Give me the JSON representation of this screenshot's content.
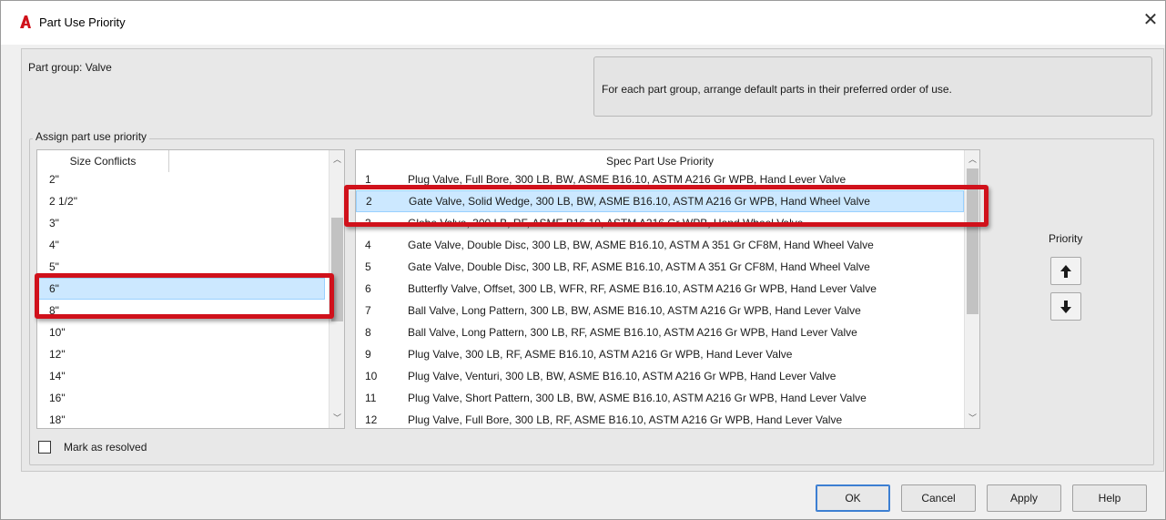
{
  "window": {
    "title": "Part Use Priority",
    "close_glyph": "✕",
    "app_icon": "autocad-icon"
  },
  "part_group_label": "Part group: Valve",
  "info_text": "For each part group, arrange default parts in their preferred order of use.",
  "group_title": "Assign part use priority",
  "size_list": {
    "header": "Size Conflicts",
    "items": [
      "2\"",
      "2 1/2\"",
      "3\"",
      "4\"",
      "5\"",
      "6\"",
      "8\"",
      "10\"",
      "12\"",
      "14\"",
      "16\"",
      "18\""
    ],
    "selected": "6\""
  },
  "spec_list": {
    "header": "Spec Part Use Priority",
    "rows": [
      {
        "num": "1",
        "text": "Plug Valve, Full Bore, 300 LB, BW, ASME B16.10, ASTM A216 Gr WPB, Hand Lever Valve"
      },
      {
        "num": "2",
        "text": "Gate Valve, Solid Wedge, 300 LB, BW, ASME B16.10, ASTM A216 Gr WPB, Hand Wheel Valve"
      },
      {
        "num": "3",
        "text": "Globe Valve, 300 LB, RF, ASME B16.10, ASTM A216 Gr WPB, Hand Wheel Valve"
      },
      {
        "num": "4",
        "text": "Gate Valve, Double Disc, 300 LB, BW, ASME B16.10, ASTM A 351 Gr CF8M, Hand Wheel Valve"
      },
      {
        "num": "5",
        "text": "Gate Valve, Double Disc, 300 LB, RF, ASME B16.10, ASTM A 351 Gr CF8M, Hand Wheel Valve"
      },
      {
        "num": "6",
        "text": "Butterfly Valve, Offset, 300 LB, WFR, RF, ASME B16.10, ASTM A216 Gr WPB, Hand Lever Valve"
      },
      {
        "num": "7",
        "text": "Ball Valve, Long Pattern, 300 LB, BW, ASME B16.10, ASTM A216 Gr WPB, Hand Lever Valve"
      },
      {
        "num": "8",
        "text": "Ball Valve, Long Pattern, 300 LB, RF, ASME B16.10, ASTM A216 Gr WPB, Hand Lever Valve"
      },
      {
        "num": "9",
        "text": "Plug Valve, 300 LB, RF, ASME B16.10, ASTM A216 Gr WPB, Hand Lever Valve"
      },
      {
        "num": "10",
        "text": "Plug Valve, Venturi, 300 LB, BW, ASME B16.10, ASTM A216 Gr WPB, Hand Lever Valve"
      },
      {
        "num": "11",
        "text": "Plug Valve, Short Pattern, 300 LB, BW, ASME B16.10, ASTM A216 Gr WPB, Hand Lever Valve"
      },
      {
        "num": "12",
        "text": "Plug Valve, Full Bore, 300 LB, RF, ASME B16.10, ASTM A216 Gr WPB, Hand Lever Valve"
      }
    ],
    "selected": "2"
  },
  "priority": {
    "label": "Priority",
    "up_icon": "arrow-up-icon",
    "down_icon": "arrow-down-icon"
  },
  "mark_resolved": {
    "label": "Mark as resolved",
    "checked": false
  },
  "buttons": {
    "ok": "OK",
    "cancel": "Cancel",
    "apply": "Apply",
    "help": "Help"
  },
  "colors": {
    "highlight_red": "#d0111b",
    "selection": "#cce8ff",
    "app_icon_red": "#d0111b"
  }
}
